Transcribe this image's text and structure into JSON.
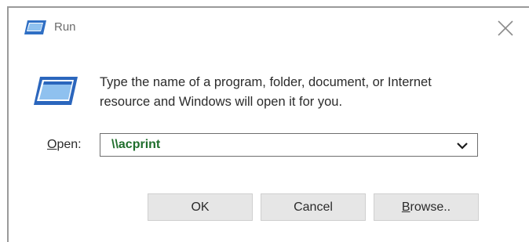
{
  "window": {
    "title": "Run",
    "icon": "run-icon"
  },
  "close": {
    "icon": "close-icon"
  },
  "description": {
    "line1": "Type the name of a program, folder, document, or Internet",
    "line2": "resource and Windows will open it for you."
  },
  "open_field": {
    "label_mnemonic": "O",
    "label_rest": "pen:",
    "value": "\\\\acprint",
    "dropdown_icon": "chevron-down-icon"
  },
  "buttons": {
    "ok": "OK",
    "cancel": "Cancel",
    "browse_mnemonic": "B",
    "browse_rest": "rowse.."
  },
  "colors": {
    "value_text": "#1f6e2c",
    "button_bg": "#e6e6e6",
    "icon_blue": "#2f6fc4"
  }
}
